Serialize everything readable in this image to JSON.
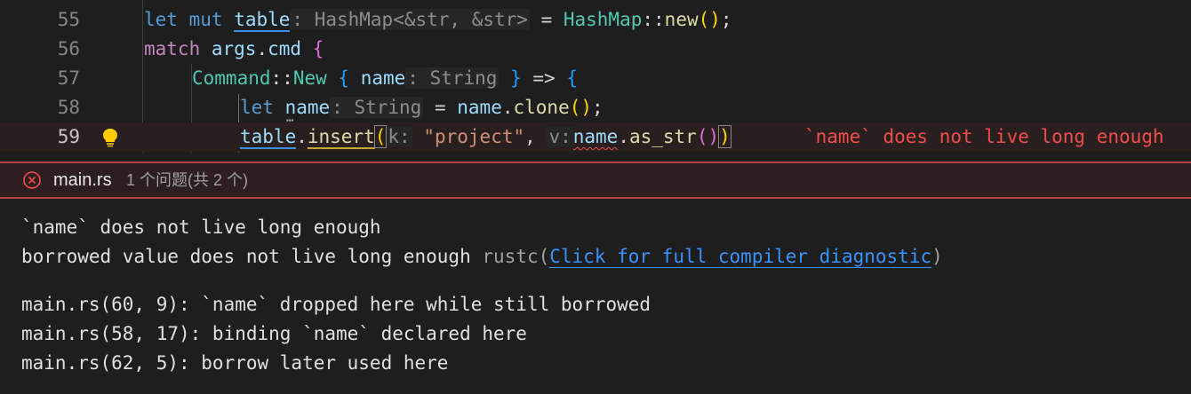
{
  "editor": {
    "lines": [
      {
        "number": "55"
      },
      {
        "number": "56"
      },
      {
        "number": "57"
      },
      {
        "number": "58"
      },
      {
        "number": "59"
      }
    ],
    "inline_error": "`name` does not live long enough"
  },
  "peek": {
    "file": "main.rs",
    "count": "1 个问题(共 2 个)",
    "message_title": "`name` does not live long enough",
    "message_detail": "borrowed value does not live long enough",
    "source": "rustc(",
    "link": "Click for full compiler diagnostic",
    "source_close": ")",
    "related": [
      "main.rs(60, 9): `name` dropped here while still borrowed",
      "main.rs(58, 17): binding `name` declared here",
      "main.rs(62, 5): borrow later used here"
    ]
  },
  "colors": {
    "error": "#f14c4c",
    "link": "#3794ff",
    "keyword": "#569cd6"
  }
}
